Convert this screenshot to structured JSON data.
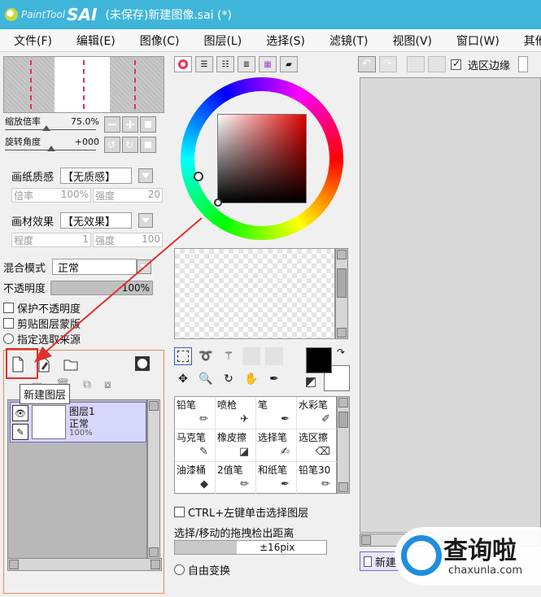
{
  "window": {
    "logo_small": "PaintTool",
    "logo_big": "SAI",
    "title": "(未保存)新建图像.sai (*)"
  },
  "menu": [
    "文件(F)",
    "编辑(E)",
    "图像(C)",
    "图层(L)",
    "选择(S)",
    "滤镜(T)",
    "视图(V)",
    "窗口(W)",
    "其他"
  ],
  "navigator": {
    "zoom_label": "缩放倍率",
    "zoom_value": "75.0%",
    "rotate_label": "旋转角度",
    "rotate_value": "+000"
  },
  "paper": {
    "texture_label": "画纸质感",
    "texture_value": "【无质感】",
    "scale_label": "倍率",
    "scale_value": "100%",
    "strength_label": "强度",
    "strength_value": "20",
    "effect_label": "画材效果",
    "effect_value": "【无效果】",
    "degree_label": "程度",
    "degree_value": "1",
    "effect_strength_label": "强度",
    "effect_strength_value": "100"
  },
  "layer_props": {
    "blend_label": "混合模式",
    "blend_value": "正常",
    "opacity_label": "不透明度",
    "opacity_value": "100%",
    "opacity_fraction": 1.0,
    "protect_opacity": "保护不透明度",
    "clip_group": "剪贴图层蒙版",
    "specify_source": "指定选取来源"
  },
  "tooltip": "新建图层",
  "layer": {
    "name": "图层1",
    "mode": "正常",
    "opacity": "100%"
  },
  "colors": {
    "primary": "#000000",
    "secondary": "#ffffff",
    "accent": "#3fb6d9",
    "annotation": "#e0302a"
  },
  "brushes": [
    {
      "name": "铅笔",
      "icon": "pencil-icon"
    },
    {
      "name": "喷枪",
      "icon": "airbrush-icon"
    },
    {
      "name": "笔",
      "icon": "pen-icon"
    },
    {
      "name": "水彩笔",
      "icon": "watercolor-icon"
    },
    {
      "name": "马克笔",
      "icon": "marker-icon"
    },
    {
      "name": "橡皮擦",
      "icon": "eraser-icon"
    },
    {
      "name": "选择笔",
      "icon": "select-pen-icon"
    },
    {
      "name": "选区擦",
      "icon": "select-eraser-icon"
    },
    {
      "name": "油漆桶",
      "icon": "bucket-icon"
    },
    {
      "name": "2值笔",
      "icon": "binary-pen-icon"
    },
    {
      "name": "和纸笔",
      "icon": "washi-pen-icon"
    },
    {
      "name": "铅笔30",
      "icon": "pencil-icon"
    }
  ],
  "options": {
    "ctrl_label": "CTRL+左键单击选择图层",
    "drag_label": "选择/移动的拖拽检出距离",
    "drag_value": "±16pix",
    "free_transform": "自由变换"
  },
  "canvas_toolbar": {
    "selection_edge": "选区边缘"
  },
  "canvas_tab": "新建",
  "watermark": {
    "text": "查询啦",
    "sub": "chaxunla.com"
  }
}
